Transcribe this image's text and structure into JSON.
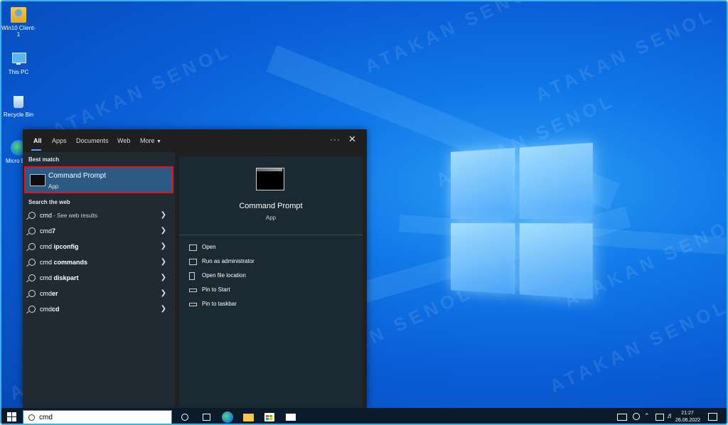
{
  "desktop": {
    "watermark": "ATAKAN SENOL",
    "icons": [
      {
        "label": "Win10 Client-1"
      },
      {
        "label": "This PC"
      },
      {
        "label": "Recycle Bin"
      },
      {
        "label": "Micro Edg"
      }
    ]
  },
  "start_menu": {
    "tabs": [
      {
        "label": "All"
      },
      {
        "label": "Apps"
      },
      {
        "label": "Documents"
      },
      {
        "label": "Web"
      },
      {
        "label": "More"
      }
    ],
    "more_icon": "ellipsis-icon",
    "close_icon": "close-icon",
    "best_match_label": "Best match",
    "best_match": {
      "title": "Command Prompt",
      "subtitle": "App"
    },
    "search_web_label": "Search the web",
    "web_results": [
      {
        "prefix": "cmd",
        "bold": "",
        "suffix": " - See web results"
      },
      {
        "prefix": "cmd",
        "bold": "7",
        "suffix": ""
      },
      {
        "prefix": "cmd ",
        "bold": "ipconfig",
        "suffix": ""
      },
      {
        "prefix": "cmd ",
        "bold": "commands",
        "suffix": ""
      },
      {
        "prefix": "cmd ",
        "bold": "diskpart",
        "suffix": ""
      },
      {
        "prefix": "cmd",
        "bold": "er",
        "suffix": ""
      },
      {
        "prefix": "cmd",
        "bold": "cd",
        "suffix": ""
      }
    ],
    "detail": {
      "title": "Command Prompt",
      "subtitle": "App",
      "actions": [
        {
          "label": "Open"
        },
        {
          "label": "Run as administrator"
        },
        {
          "label": "Open file location"
        },
        {
          "label": "Pin to Start"
        },
        {
          "label": "Pin to taskbar"
        }
      ]
    }
  },
  "taskbar": {
    "search_value": "cmd",
    "clock_time": "21:27",
    "clock_date": "26.06.2022"
  }
}
